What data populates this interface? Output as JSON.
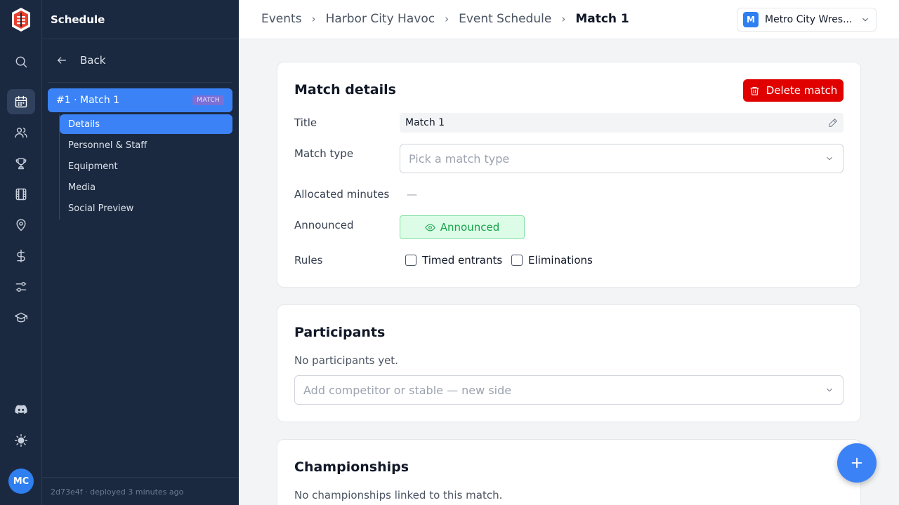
{
  "sidebar": {
    "title": "Schedule",
    "back_label": "Back",
    "match_item": {
      "label": "#1 · Match 1",
      "badge": "MATCH"
    },
    "subnav": [
      {
        "label": "Details",
        "active": true
      },
      {
        "label": "Personnel & Staff",
        "active": false
      },
      {
        "label": "Equipment",
        "active": false
      },
      {
        "label": "Media",
        "active": false
      },
      {
        "label": "Social Preview",
        "active": false
      }
    ],
    "footer": {
      "commit": "2d73e4f",
      "deploy_text": " · deployed 3 minutes ago"
    }
  },
  "rail": {
    "avatar_initials": "MC",
    "icons": [
      "search-icon",
      "calendar-icon",
      "users-icon",
      "trophy-icon",
      "film-icon",
      "map-pin-icon",
      "dollar-icon",
      "sliders-icon",
      "graduation-cap-icon",
      "discord-icon",
      "sun-icon"
    ],
    "active_icon": "calendar-icon"
  },
  "breadcrumb": [
    "Events",
    "Harbor City Havoc",
    "Event Schedule",
    "Match 1"
  ],
  "org_switcher": {
    "initial": "M",
    "name": "Metro City Wres..."
  },
  "match_details": {
    "heading": "Match details",
    "delete_label": "Delete match",
    "title_label": "Title",
    "title_value": "Match 1",
    "match_type_label": "Match type",
    "match_type_placeholder": "Pick a match type",
    "allocated_label": "Allocated minutes",
    "allocated_value": "—",
    "announced_label": "Announced",
    "announced_status": "Announced",
    "rules_label": "Rules",
    "rule_timed": "Timed entrants",
    "rule_elim": "Eliminations"
  },
  "participants": {
    "heading": "Participants",
    "empty_text": "No participants yet.",
    "add_placeholder": "Add competitor or stable — new side"
  },
  "championships": {
    "heading": "Championships",
    "empty_text": "No championships linked to this match."
  },
  "colors": {
    "primary": "#3b82f6",
    "danger": "#e00000",
    "sidebar_bg": "#1b2940",
    "success": "#16a34a"
  }
}
